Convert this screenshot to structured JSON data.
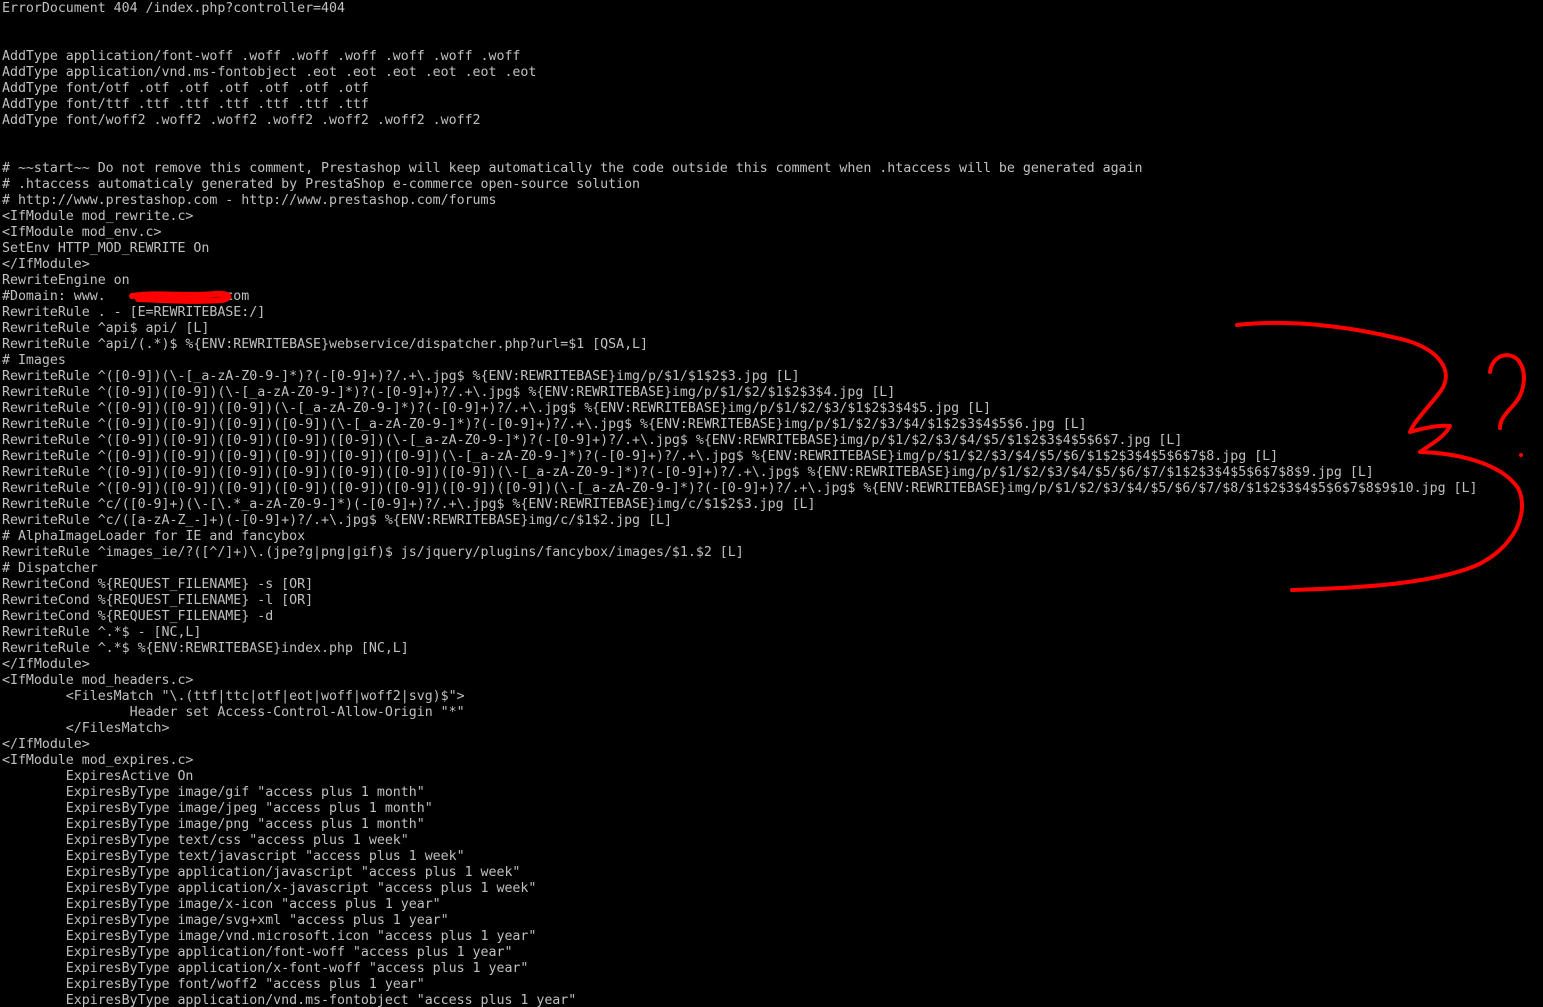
{
  "terminal": {
    "colors": {
      "background": "#000000",
      "text": "#c0c0c0",
      "annotation": "#ff0000"
    },
    "lines": [
      "ErrorDocument 404 /index.php?controller=404",
      "",
      "",
      "AddType application/font-woff .woff .woff .woff .woff .woff .woff",
      "AddType application/vnd.ms-fontobject .eot .eot .eot .eot .eot .eot",
      "AddType font/otf .otf .otf .otf .otf .otf .otf",
      "AddType font/ttf .ttf .ttf .ttf .ttf .ttf .ttf",
      "AddType font/woff2 .woff2 .woff2 .woff2 .woff2 .woff2 .woff2",
      "",
      "",
      "# ~~start~~ Do not remove this comment, Prestashop will keep automatically the code outside this comment when .htaccess will be generated again",
      "# .htaccess automaticaly generated by PrestaShop e-commerce open-source solution",
      "# http://www.prestashop.com - http://www.prestashop.com/forums",
      "<IfModule mod_rewrite.c>",
      "<IfModule mod_env.c>",
      "SetEnv HTTP_MOD_REWRITE On",
      "</IfModule>",
      "RewriteEngine on",
      "#Domain: www.              .com",
      "RewriteRule . - [E=REWRITEBASE:/]",
      "RewriteRule ^api$ api/ [L]",
      "RewriteRule ^api/(.*)$ %{ENV:REWRITEBASE}webservice/dispatcher.php?url=$1 [QSA,L]",
      "# Images",
      "RewriteRule ^([0-9])(\\-[_a-zA-Z0-9-]*)?(-[0-9]+)?/.+\\.jpg$ %{ENV:REWRITEBASE}img/p/$1/$1$2$3.jpg [L]",
      "RewriteRule ^([0-9])([0-9])(\\-[_a-zA-Z0-9-]*)?(-[0-9]+)?/.+\\.jpg$ %{ENV:REWRITEBASE}img/p/$1/$2/$1$2$3$4.jpg [L]",
      "RewriteRule ^([0-9])([0-9])([0-9])(\\-[_a-zA-Z0-9-]*)?(-[0-9]+)?/.+\\.jpg$ %{ENV:REWRITEBASE}img/p/$1/$2/$3/$1$2$3$4$5.jpg [L]",
      "RewriteRule ^([0-9])([0-9])([0-9])([0-9])(\\-[_a-zA-Z0-9-]*)?(-[0-9]+)?/.+\\.jpg$ %{ENV:REWRITEBASE}img/p/$1/$2/$3/$4/$1$2$3$4$5$6.jpg [L]",
      "RewriteRule ^([0-9])([0-9])([0-9])([0-9])([0-9])(\\-[_a-zA-Z0-9-]*)?(-[0-9]+)?/.+\\.jpg$ %{ENV:REWRITEBASE}img/p/$1/$2/$3/$4/$5/$1$2$3$4$5$6$7.jpg [L]",
      "RewriteRule ^([0-9])([0-9])([0-9])([0-9])([0-9])([0-9])(\\-[_a-zA-Z0-9-]*)?(-[0-9]+)?/.+\\.jpg$ %{ENV:REWRITEBASE}img/p/$1/$2/$3/$4/$5/$6/$1$2$3$4$5$6$7$8.jpg [L]",
      "RewriteRule ^([0-9])([0-9])([0-9])([0-9])([0-9])([0-9])([0-9])(\\-[_a-zA-Z0-9-]*)?(-[0-9]+)?/.+\\.jpg$ %{ENV:REWRITEBASE}img/p/$1/$2/$3/$4/$5/$6/$7/$1$2$3$4$5$6$7$8$9.jpg [L]",
      "RewriteRule ^([0-9])([0-9])([0-9])([0-9])([0-9])([0-9])([0-9])([0-9])(\\-[_a-zA-Z0-9-]*)?(-[0-9]+)?/.+\\.jpg$ %{ENV:REWRITEBASE}img/p/$1/$2/$3/$4/$5/$6/$7/$8/$1$2$3$4$5$6$7$8$9$10.jpg [L]",
      "RewriteRule ^c/([0-9]+)(\\-[\\.*_a-zA-Z0-9-]*)(-[0-9]+)?/.+\\.jpg$ %{ENV:REWRITEBASE}img/c/$1$2$3.jpg [L]",
      "RewriteRule ^c/([a-zA-Z_-]+)(-[0-9]+)?/.+\\.jpg$ %{ENV:REWRITEBASE}img/c/$1$2.jpg [L]",
      "# AlphaImageLoader for IE and fancybox",
      "RewriteRule ^images_ie/?([^/]+)\\.(jpe?g|png|gif)$ js/jquery/plugins/fancybox/images/$1.$2 [L]",
      "# Dispatcher",
      "RewriteCond %{REQUEST_FILENAME} -s [OR]",
      "RewriteCond %{REQUEST_FILENAME} -l [OR]",
      "RewriteCond %{REQUEST_FILENAME} -d",
      "RewriteRule ^.*$ - [NC,L]",
      "RewriteRule ^.*$ %{ENV:REWRITEBASE}index.php [NC,L]",
      "</IfModule>",
      "<IfModule mod_headers.c>",
      "        <FilesMatch \"\\.(ttf|ttc|otf|eot|woff|woff2|svg)$\">",
      "                Header set Access-Control-Allow-Origin \"*\"",
      "        </FilesMatch>",
      "</IfModule>",
      "<IfModule mod_expires.c>",
      "        ExpiresActive On",
      "        ExpiresByType image/gif \"access plus 1 month\"",
      "        ExpiresByType image/jpeg \"access plus 1 month\"",
      "        ExpiresByType image/png \"access plus 1 month\"",
      "        ExpiresByType text/css \"access plus 1 week\"",
      "        ExpiresByType text/javascript \"access plus 1 week\"",
      "        ExpiresByType application/javascript \"access plus 1 week\"",
      "        ExpiresByType application/x-javascript \"access plus 1 week\"",
      "        ExpiresByType image/x-icon \"access plus 1 year\"",
      "        ExpiresByType image/svg+xml \"access plus 1 year\"",
      "        ExpiresByType image/vnd.microsoft.icon \"access plus 1 year\"",
      "        ExpiresByType application/font-woff \"access plus 1 year\"",
      "        ExpiresByType application/x-font-woff \"access plus 1 year\"",
      "        ExpiresByType font/woff2 \"access plus 1 year\"",
      "        ExpiresByType application/vnd.ms-fontobject \"access plus 1 year\""
    ]
  }
}
